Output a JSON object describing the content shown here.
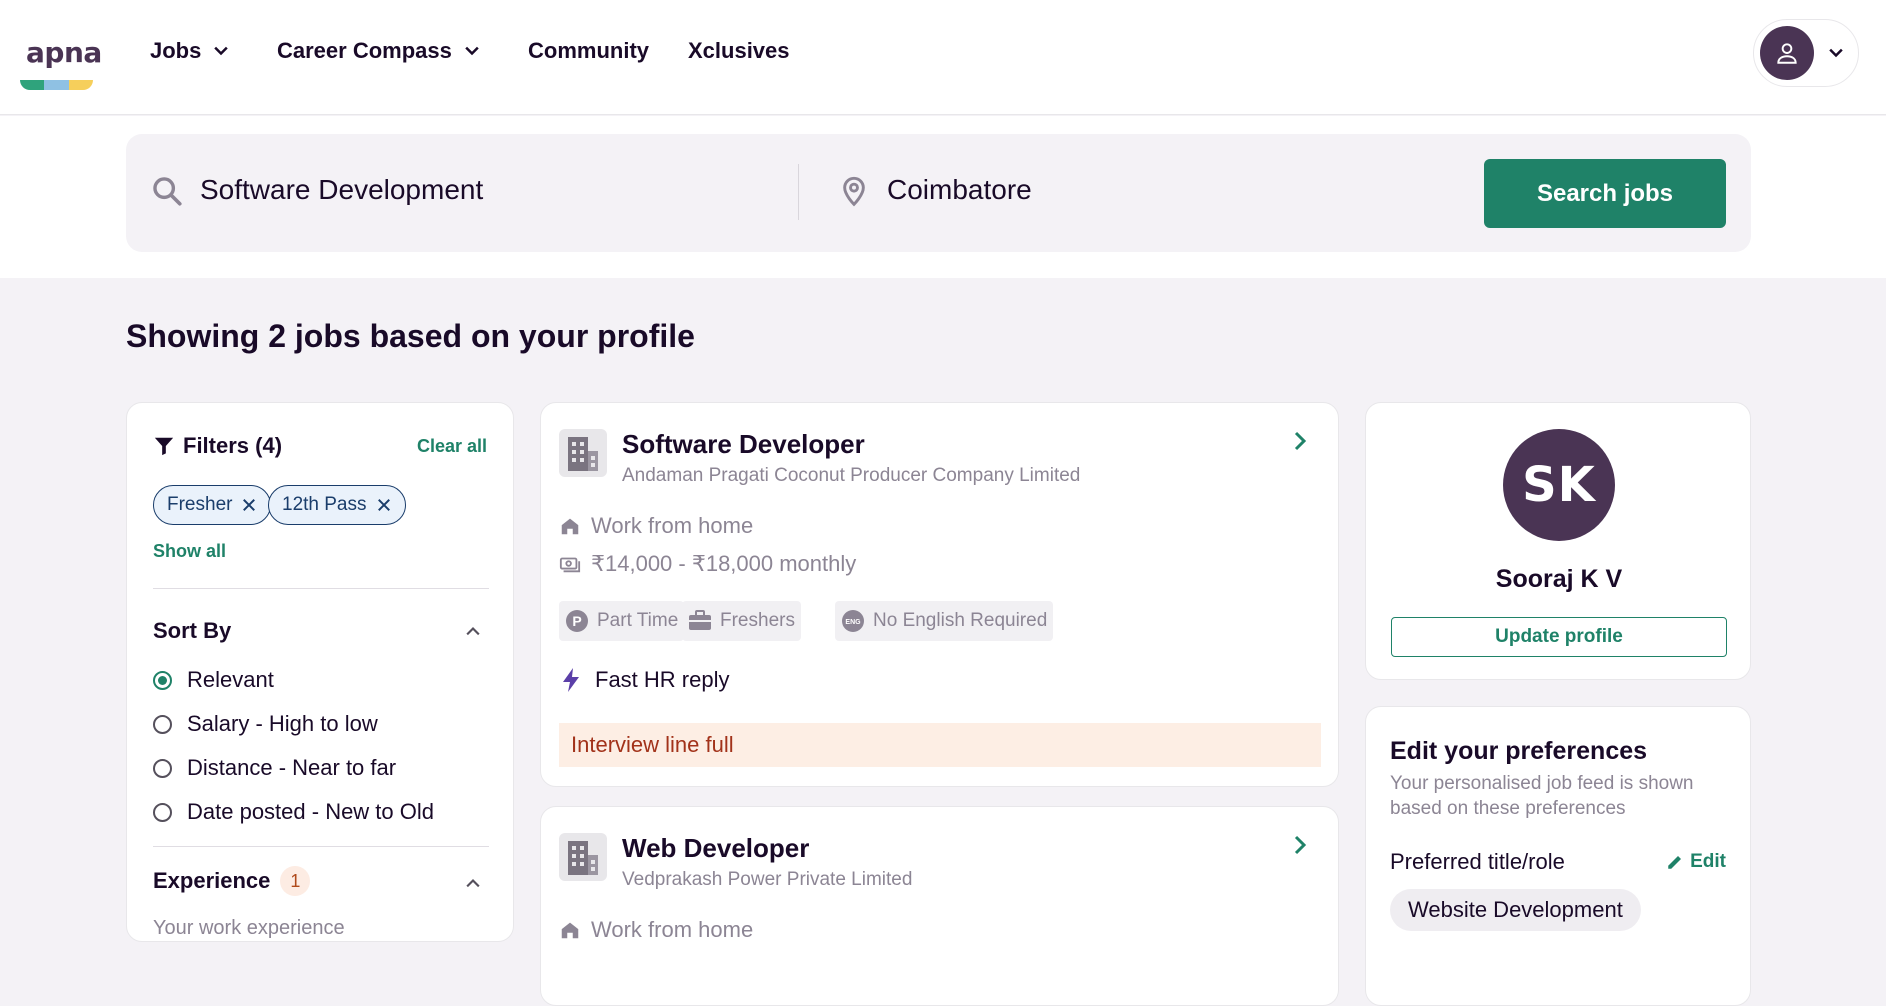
{
  "brand": {
    "logo_text": "apna",
    "colors": [
      "#2fa37c",
      "#8fc1e3",
      "#f6cf5b"
    ]
  },
  "nav": {
    "items": [
      {
        "label": "Jobs",
        "has_dropdown": true
      },
      {
        "label": "Career Compass",
        "has_dropdown": true
      },
      {
        "label": "Community",
        "has_dropdown": false
      },
      {
        "label": "Xclusives",
        "has_dropdown": false
      }
    ]
  },
  "search": {
    "query": "Software Development",
    "location": "Coimbatore",
    "button_label": "Search jobs"
  },
  "results_heading": "Showing 2 jobs based on your profile",
  "filters": {
    "title": "Filters (4)",
    "clear_all": "Clear all",
    "chips": [
      "Fresher",
      "12th Pass"
    ],
    "show_all": "Show all",
    "sort_by": {
      "title": "Sort By",
      "options": [
        {
          "label": "Relevant",
          "selected": true
        },
        {
          "label": "Salary - High to low",
          "selected": false
        },
        {
          "label": "Distance - Near to far",
          "selected": false
        },
        {
          "label": "Date posted - New to Old",
          "selected": false
        }
      ]
    },
    "experience": {
      "title": "Experience",
      "count": "1",
      "subtitle": "Your work experience"
    }
  },
  "jobs": [
    {
      "title": "Software Developer",
      "company": "Andaman Pragati Coconut Producer Company Limited",
      "work_mode": "Work from home",
      "salary": "₹14,000 - ₹18,000 monthly",
      "tags": [
        "Part Time",
        "Freshers",
        "No English Required"
      ],
      "hr_reply": "Fast HR reply",
      "status": "Interview line full"
    },
    {
      "title": "Web Developer",
      "company": "Vedprakash Power Private Limited",
      "work_mode": "Work from home"
    }
  ],
  "profile": {
    "initials": "SK",
    "name": "Sooraj K V",
    "update_label": "Update profile"
  },
  "preferences": {
    "title": "Edit your preferences",
    "subtitle": "Your personalised job feed is shown based on these preferences",
    "label": "Preferred title/role",
    "edit_label": "Edit",
    "chip": "Website Development"
  },
  "colors": {
    "accent": "#1f8268",
    "brand_purple": "#4a3454",
    "warning_bg": "#fdeee4",
    "warning_text": "#a2321a"
  }
}
